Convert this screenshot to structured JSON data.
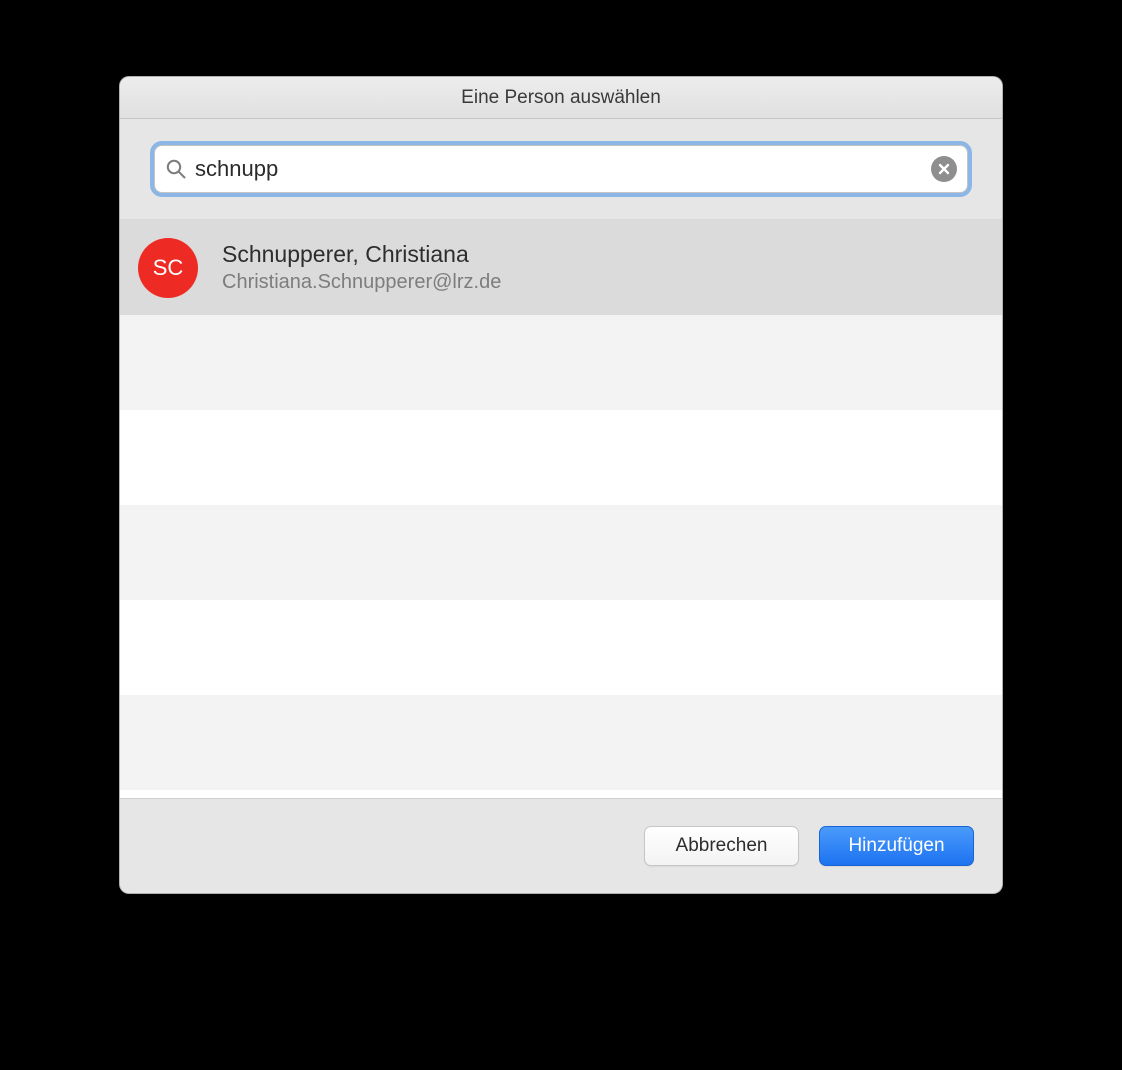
{
  "dialog": {
    "title": "Eine Person auswählen"
  },
  "search": {
    "value": "schnupp",
    "placeholder": "",
    "icon": "search-icon",
    "clear_icon": "clear-icon"
  },
  "results": [
    {
      "avatar_initials": "SC",
      "avatar_color": "#ee2a24",
      "name": "Schnupperer, Christiana",
      "sub": "Christiana.Schnupperer@lrz.de",
      "selected": true
    }
  ],
  "buttons": {
    "cancel": "Abbrechen",
    "add": "Hinzufügen"
  }
}
